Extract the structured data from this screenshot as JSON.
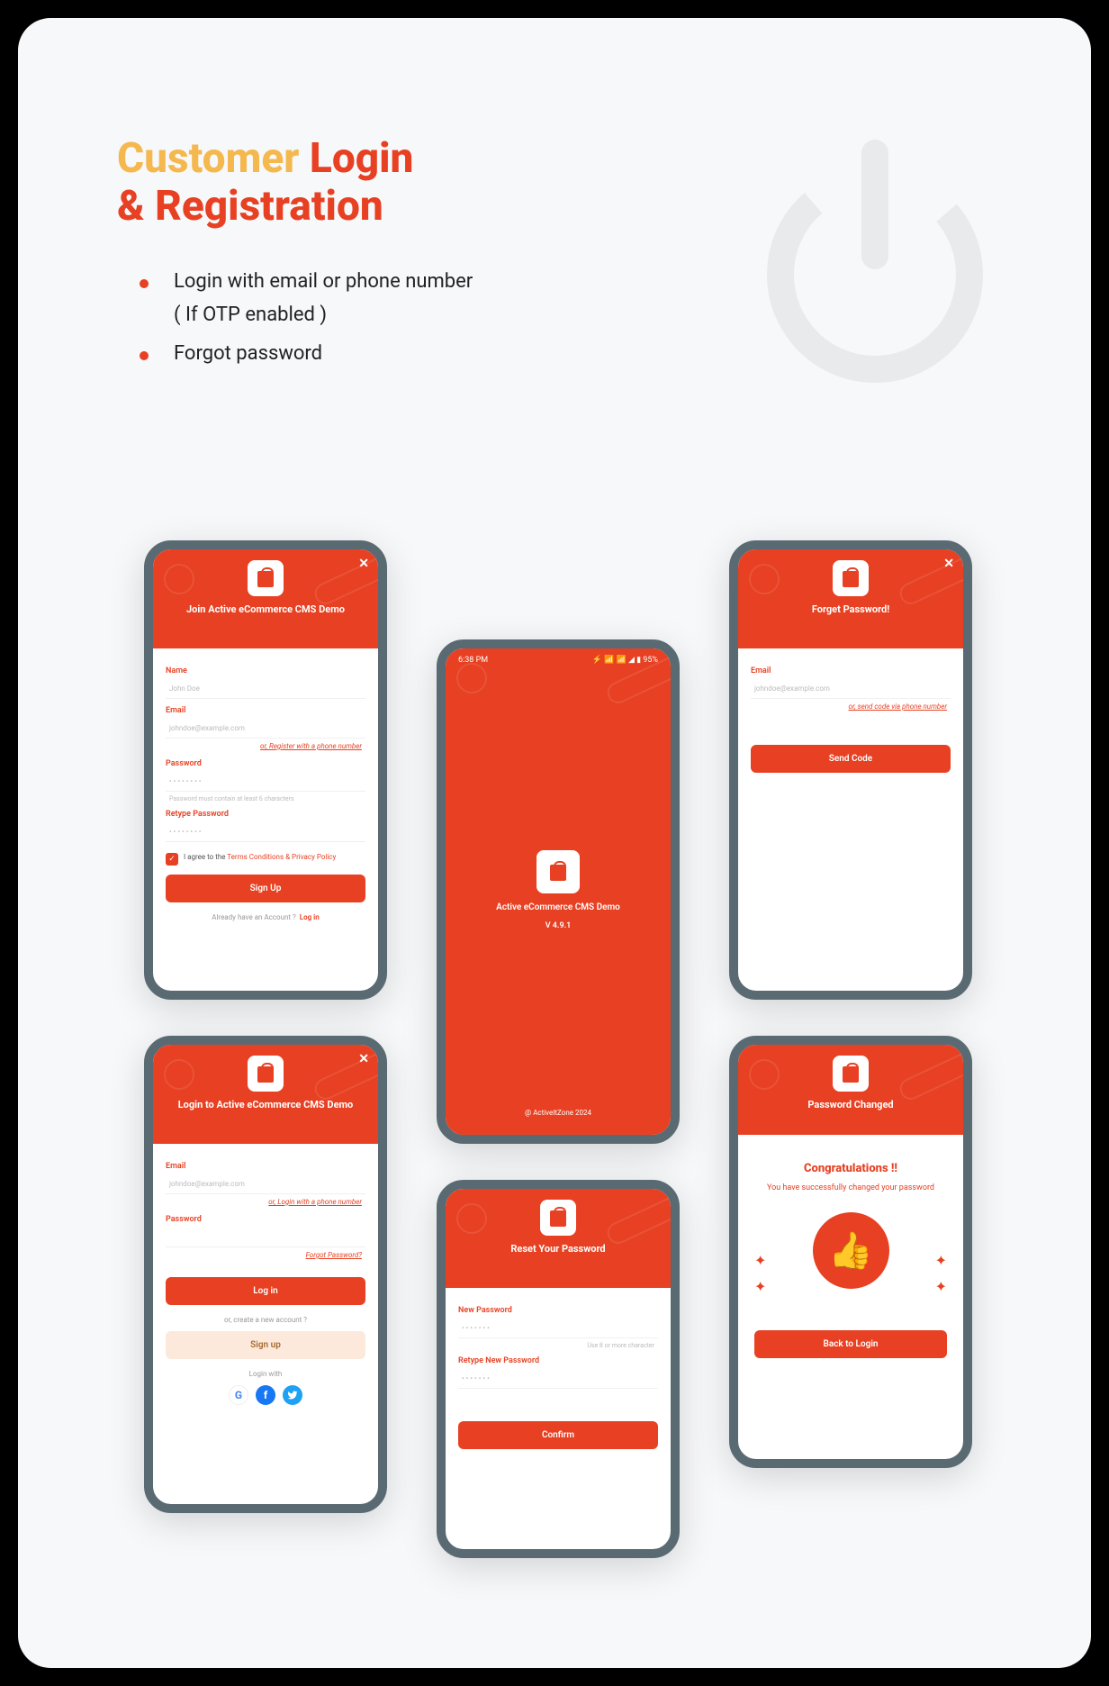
{
  "heading": {
    "customer": "Customer",
    "login": "Login",
    "amp_reg": "& Registration"
  },
  "bullets": {
    "item1": "Login with email or phone number",
    "item1_sub": "( If OTP enabled )",
    "item2": "Forgot password"
  },
  "signup": {
    "title": "Join Active eCommerce CMS Demo",
    "name_label": "Name",
    "name_placeholder": "John Doe",
    "email_label": "Email",
    "email_placeholder": "johndoe@example.com",
    "email_alt": "or, Register with a phone number",
    "password_label": "Password",
    "password_placeholder": "• • • • • • • •",
    "password_help": "Password must contain at least 6 characters",
    "retype_label": "Retype Password",
    "retype_placeholder": "• • • • • • • •",
    "agree_pre": "I agree to the",
    "agree_terms": "Terms Conditions & Privacy Policy",
    "btn": "Sign Up",
    "have_account": "Already have an Account ?",
    "login_link": "Log in"
  },
  "login": {
    "title": "Login to Active eCommerce CMS Demo",
    "email_label": "Email",
    "email_placeholder": "johndoe@example.com",
    "email_alt": "or, Login with a phone number",
    "password_label": "Password",
    "forgot": "Forgot Password?",
    "login_btn": "Log in",
    "create_prompt": "or, create a new account ?",
    "signup_btn": "Sign up",
    "login_with": "Login with"
  },
  "splash": {
    "time": "6:38 PM",
    "status_right": "⚡ 📶 📶 ◢ ▮ 95%",
    "title": "Active eCommerce CMS Demo",
    "version": "V 4.9.1",
    "footer": "@ ActiveItZone 2024"
  },
  "forgot": {
    "title": "Forget Password!",
    "email_label": "Email",
    "email_placeholder": "johndoe@example.com",
    "alt": "or, send code via phone number",
    "btn": "Send Code"
  },
  "reset": {
    "title": "Reset Your Password",
    "new_label": "New Password",
    "placeholder": "• • • • • • •",
    "help": "Use 8 or more character",
    "retype_label": "Retype New Password",
    "btn": "Confirm"
  },
  "success": {
    "title": "Password Changed",
    "congrats": "Congratulations !!",
    "msg": "You have successfully changed your password",
    "btn": "Back to Login"
  }
}
